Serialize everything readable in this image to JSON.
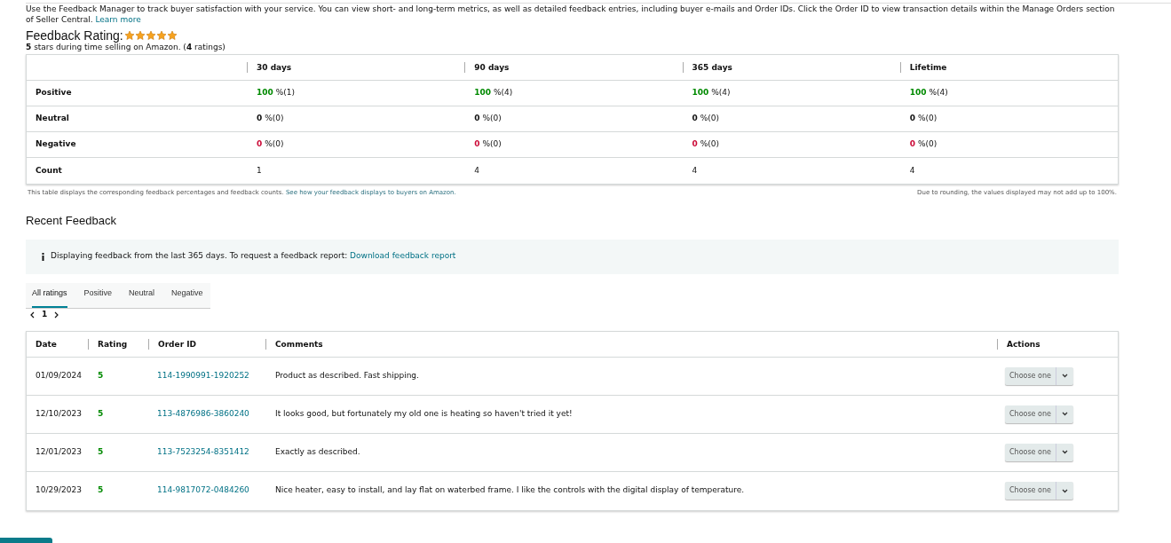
{
  "intro": {
    "text": "Use the Feedback Manager to track buyer satisfaction with your service. You can view short- and long-term metrics, as well as detailed feedback entries, including buyer e-mails and Order IDs. Click the Order ID to view transaction details within the Manage Orders section of Seller Central.",
    "link": "Learn more"
  },
  "rating": {
    "title": "Feedback Rating:",
    "stars": 5,
    "summary": "**5** stars during time selling on Amazon. (**4** ratings)"
  },
  "metrics": {
    "columns": [
      "30 days",
      "90 days",
      "365 days",
      "Lifetime"
    ],
    "rows": [
      {
        "label": "Positive",
        "kind": "positive",
        "cells": [
          {
            "value": "100",
            "rest": "%(1)"
          },
          {
            "value": "100",
            "rest": "%(4)"
          },
          {
            "value": "100",
            "rest": "%(4)"
          },
          {
            "value": "100",
            "rest": "%(4)"
          }
        ]
      },
      {
        "label": "Neutral",
        "kind": "neutral",
        "cells": [
          {
            "value": "0",
            "rest": "%(0)"
          },
          {
            "value": "0",
            "rest": "%(0)"
          },
          {
            "value": "0",
            "rest": "%(0)"
          },
          {
            "value": "0",
            "rest": "%(0)"
          }
        ]
      },
      {
        "label": "Negative",
        "kind": "negative",
        "cells": [
          {
            "value": "0",
            "rest": "%(0)"
          },
          {
            "value": "0",
            "rest": "%(0)"
          },
          {
            "value": "0",
            "rest": "%(0)"
          },
          {
            "value": "0",
            "rest": "%(0)"
          }
        ]
      },
      {
        "label": "Count",
        "kind": "count",
        "cells": [
          {
            "value": "1"
          },
          {
            "value": "4"
          },
          {
            "value": "4"
          },
          {
            "value": "4"
          }
        ]
      }
    ],
    "note": "This table displays the corresponding feedback percentages and feedback counts.",
    "note_link": "See how your feedback displays to buyers on Amazon.",
    "rounding_note": "Due to rounding, the values displayed may not add up to 100%."
  },
  "recent": {
    "title": "Recent Feedback",
    "info": "Displaying feedback from the last 365 days. To request a feedback report:",
    "info_link": "Download feedback report",
    "tabs": [
      {
        "label": "All ratings",
        "selected": true
      },
      {
        "label": "Positive",
        "selected": false
      },
      {
        "label": "Neutral",
        "selected": false
      },
      {
        "label": "Negative",
        "selected": false
      }
    ],
    "page": "1",
    "columns": [
      "Date",
      "Rating",
      "Order ID",
      "Comments",
      "Actions"
    ],
    "rows": [
      {
        "date": "01/09/2024",
        "rating": "5",
        "order_id": "114-1990991-1920252",
        "comment": "Product as described. Fast shipping.",
        "action": "Choose one"
      },
      {
        "date": "12/10/2023",
        "rating": "5",
        "order_id": "113-4876986-3860240",
        "comment": "It looks good, but fortunately my old one is heating so haven't tried it yet!",
        "action": "Choose one"
      },
      {
        "date": "12/01/2023",
        "rating": "5",
        "order_id": "113-7523254-8351412",
        "comment": "Exactly as described.",
        "action": "Choose one"
      },
      {
        "date": "10/29/2023",
        "rating": "5",
        "order_id": "114-9817072-0484260",
        "comment": "Nice heater, easy to install, and lay flat on waterbed frame. I like the controls with the digital display of temperature.",
        "action": "Choose one"
      }
    ]
  }
}
